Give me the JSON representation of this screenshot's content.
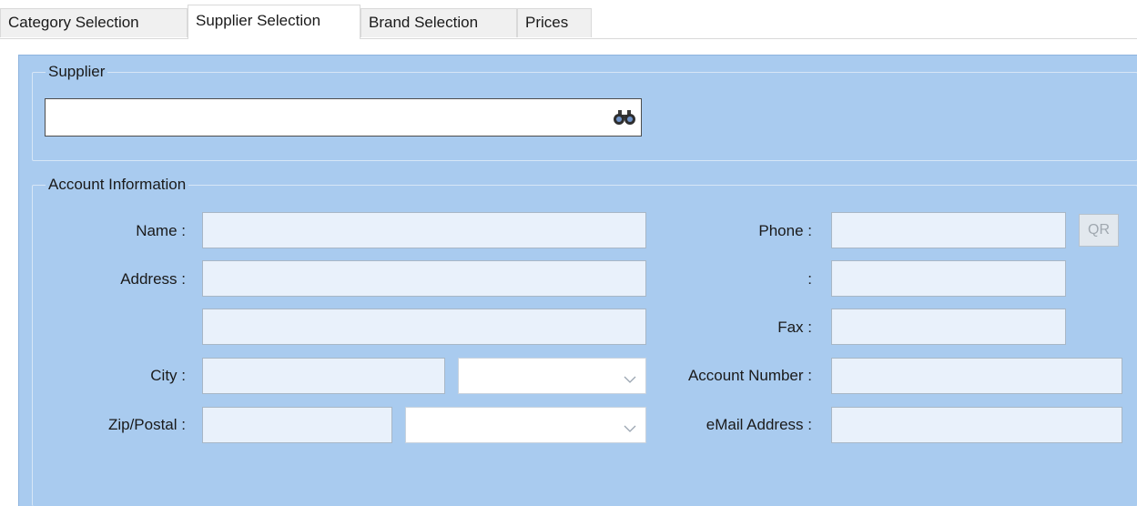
{
  "tabs": [
    {
      "label": "Category Selection"
    },
    {
      "label": "Supplier Selection"
    },
    {
      "label": "Brand Selection"
    },
    {
      "label": "Prices"
    }
  ],
  "active_tab": "Supplier Selection",
  "supplier": {
    "legend": "Supplier",
    "search_value": ""
  },
  "account": {
    "legend": "Account Information",
    "name_label": "Name :",
    "address_label": "Address :",
    "city_label": "City :",
    "zip_label": "Zip/Postal :",
    "phone_label": "Phone :",
    "phone2_label": ":",
    "fax_label": "Fax :",
    "account_number_label": "Account Number :",
    "email_label": "eMail Address :",
    "qr_label": "QR"
  },
  "icons": {
    "search": "binoculars-icon",
    "dropdown": "chevron-down-icon"
  },
  "colors": {
    "panel_bg": "#a9cbef",
    "field_bg": "#e9f1fb",
    "active_tab_bg": "#ffffff"
  }
}
